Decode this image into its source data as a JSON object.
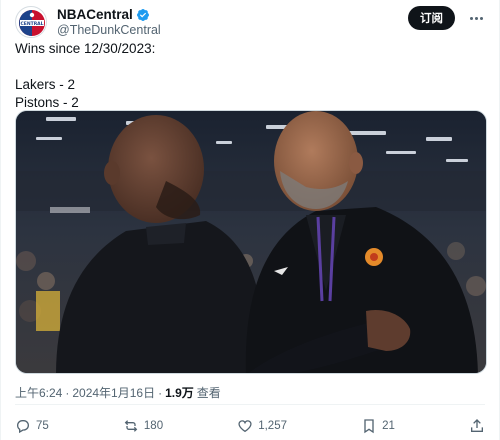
{
  "author": {
    "display_name": "NBACentral",
    "handle": "@TheDunkCentral",
    "verified": true,
    "avatar_icon": "nba-central-logo"
  },
  "subscribe_label": "订阅",
  "tweet": {
    "lines": [
      "Wins since 12/30/2023:",
      "",
      "Lakers - 2",
      "Pistons - 2"
    ]
  },
  "meta": {
    "time": "上午6:24",
    "separator": "·",
    "date": "2024年1月16日",
    "views_count": "1.9万",
    "views_label": "查看"
  },
  "actions": {
    "replies": "75",
    "reposts": "180",
    "likes": "1,257",
    "bookmarks": "21"
  },
  "colors": {
    "text": "#0f1419",
    "secondary": "#536471",
    "verified": "#1d9bf0",
    "button_bg": "#0f1419"
  }
}
